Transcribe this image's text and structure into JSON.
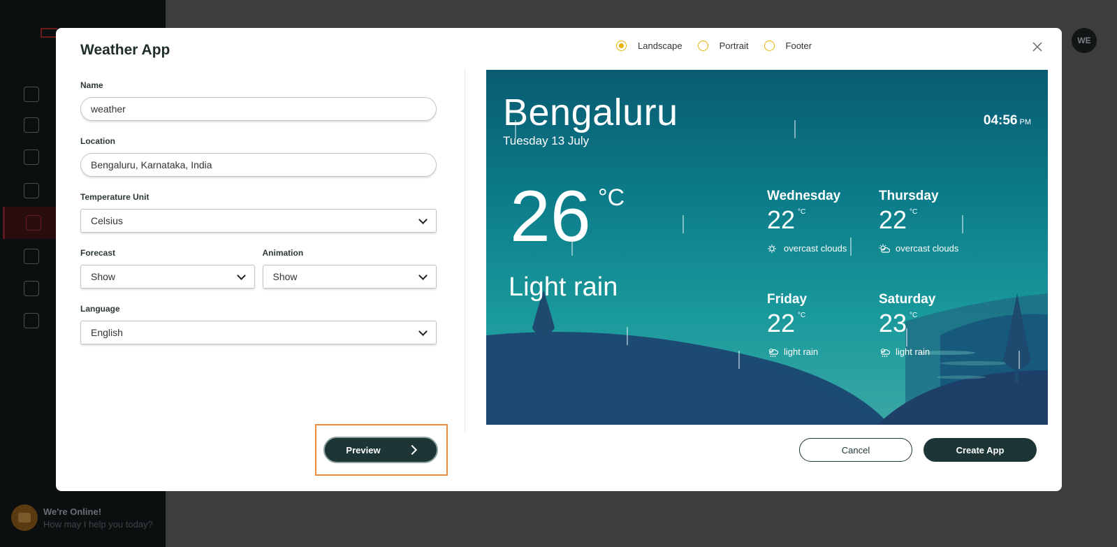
{
  "modal": {
    "title": "Weather App",
    "orientation_options": [
      "Landscape",
      "Portrait",
      "Footer"
    ],
    "selected_orientation": "Landscape"
  },
  "form": {
    "name_label": "Name",
    "name_value": "weather",
    "location_label": "Location",
    "location_value": "Bengaluru, Karnataka, India",
    "temp_unit_label": "Temperature Unit",
    "temp_unit_value": "Celsius",
    "forecast_label": "Forecast",
    "forecast_value": "Show",
    "animation_label": "Animation",
    "animation_value": "Show",
    "language_label": "Language",
    "language_value": "English"
  },
  "buttons": {
    "preview": "Preview",
    "cancel": "Cancel",
    "create": "Create App"
  },
  "weather": {
    "city": "Bengaluru",
    "date": "Tuesday 13 July",
    "time": "04:56",
    "ampm": "PM",
    "temp": "26",
    "unit": "°C",
    "condition": "Light rain",
    "forecast": [
      {
        "day": "Wednesday",
        "temp": "22",
        "unit": "°C",
        "desc": "overcast clouds"
      },
      {
        "day": "Thursday",
        "temp": "22",
        "unit": "°C",
        "desc": "overcast clouds"
      },
      {
        "day": "Friday",
        "temp": "22",
        "unit": "°C",
        "desc": "light rain"
      },
      {
        "day": "Saturday",
        "temp": "23",
        "unit": "°C",
        "desc": "light rain"
      }
    ]
  },
  "background": {
    "avatar": "WE",
    "chat_title": "We're Online!",
    "chat_subtitle": "How may I help you today?"
  },
  "colors": {
    "accent": "#e8b100",
    "primary": "#1d3535",
    "highlight": "#f08a3c"
  }
}
